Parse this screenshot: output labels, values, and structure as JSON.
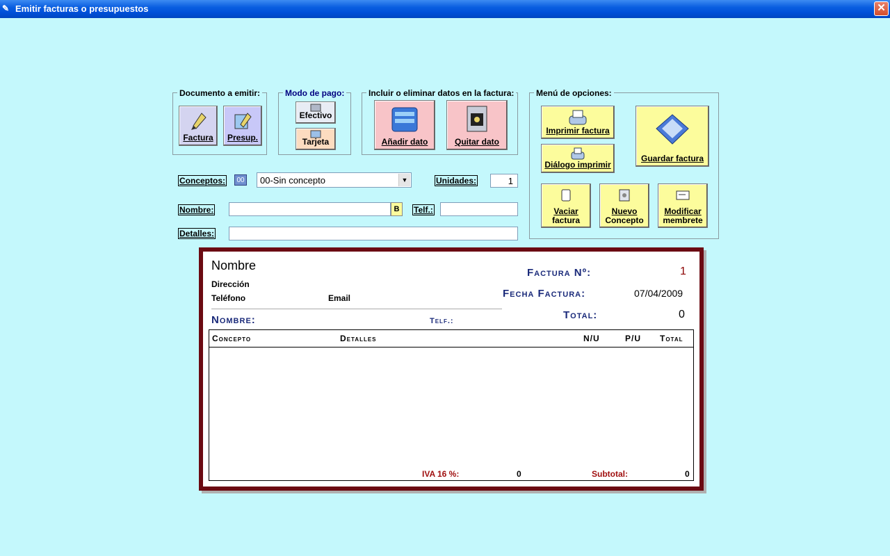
{
  "window": {
    "title": "Emitir facturas o presupuestos",
    "close_glyph": "✕"
  },
  "documento": {
    "legend": "Documento a emitir:",
    "factura": "Factura",
    "presup": "Presup."
  },
  "pago": {
    "legend": "Modo de pago:",
    "efectivo": "Efectivo",
    "tarjeta": "Tarjeta"
  },
  "datos": {
    "legend": "Incluir o eliminar datos en la factura:",
    "anadir": "Añadir dato",
    "quitar": "Quitar dato"
  },
  "menu": {
    "legend": "Menú de opciones:",
    "imprimir": "Imprimir factura",
    "dialogo": "Diálogo imprimir",
    "guardar": "Guardar factura",
    "vaciar_1": "Vaciar",
    "vaciar_2": "factura",
    "nuevo_1": "Nuevo",
    "nuevo_2": "Concepto",
    "modificar_1": "Modificar",
    "modificar_2": "membrete"
  },
  "form": {
    "conceptos_label": "Conceptos:",
    "conceptos_code": "00",
    "concepto_selected": "00-Sin concepto",
    "unidades_label": "Unidades:",
    "unidades_value": "1",
    "nombre_label": "Nombre:",
    "nombre_value": "",
    "b_button": "B",
    "telf_label": "Telf.:",
    "telf_value": "",
    "detalles_label": "Detalles:",
    "detalles_value": ""
  },
  "invoice": {
    "nombre": "Nombre",
    "direccion": "Dirección",
    "telefono": "Teléfono",
    "email": "Email",
    "factura_no_label": "Factura Nº:",
    "factura_no": "1",
    "fecha_label": "Fecha Factura:",
    "fecha": "07/04/2009",
    "total_label": "Total:",
    "total": "0",
    "cliente_nombre_label": "Nombre:",
    "cliente_telf_label": "Telf.:",
    "columns": [
      "Concepto",
      "Detalles",
      "N/U",
      "P/U",
      "Total"
    ],
    "iva_label": "IVA 16 %:",
    "iva_value": "0",
    "subtotal_label": "Subtotal:",
    "subtotal_value": "0"
  },
  "colors": {
    "background": "#c4f8fc",
    "frame": "#6b0a12",
    "accent_navy": "#1a2a7a"
  }
}
